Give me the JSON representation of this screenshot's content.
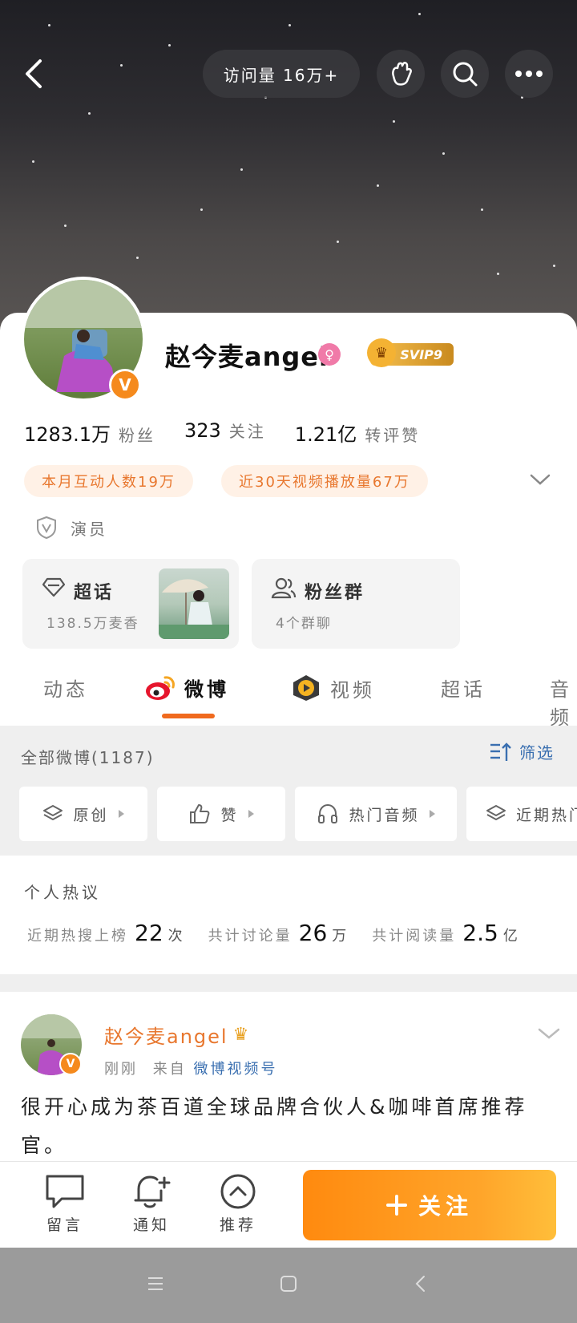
{
  "header": {
    "visit_count": "访问量 16万+",
    "accent": "#f06a1e"
  },
  "profile": {
    "name": "赵今麦angel",
    "vip_label": "SVIP9",
    "stats": [
      {
        "num": "1283.1万",
        "label": "粉丝"
      },
      {
        "num": "323",
        "label": "关注"
      },
      {
        "num": "1.21亿",
        "label": "转评赞"
      }
    ],
    "chips": [
      "本月互动人数19万",
      "近30天视频播放量67万"
    ],
    "role": "演员",
    "super_topic": {
      "title": "超话",
      "sub": "138.5万麦香"
    },
    "fan_group": {
      "title": "粉丝群",
      "sub": "4个群聊"
    }
  },
  "tabs": [
    {
      "label": "动态"
    },
    {
      "label": "微博"
    },
    {
      "label": "视频"
    },
    {
      "label": "超话"
    },
    {
      "label": "音频"
    }
  ],
  "feed": {
    "all_label": "全部微博(1187)",
    "filter_label": "筛选",
    "filter_chips": [
      "原创",
      "赞",
      "热门音频",
      "近期热门"
    ]
  },
  "hot": {
    "title": "个人热议",
    "items": [
      {
        "label": "近期热搜上榜",
        "num": "22",
        "unit": "次"
      },
      {
        "label": "共计讨论量",
        "num": "26",
        "unit": "万"
      },
      {
        "label": "共计阅读量",
        "num": "2.5",
        "unit": "亿"
      }
    ]
  },
  "post": {
    "author": "赵今麦angel",
    "time": "刚刚",
    "from_prefix": "来自",
    "source": "微博视频号",
    "text": "很开心成为茶百道全球品牌合伙人&咖啡首席推荐官。"
  },
  "actions": {
    "comment": "留言",
    "notify": "通知",
    "recommend": "推荐",
    "follow": "关注"
  }
}
